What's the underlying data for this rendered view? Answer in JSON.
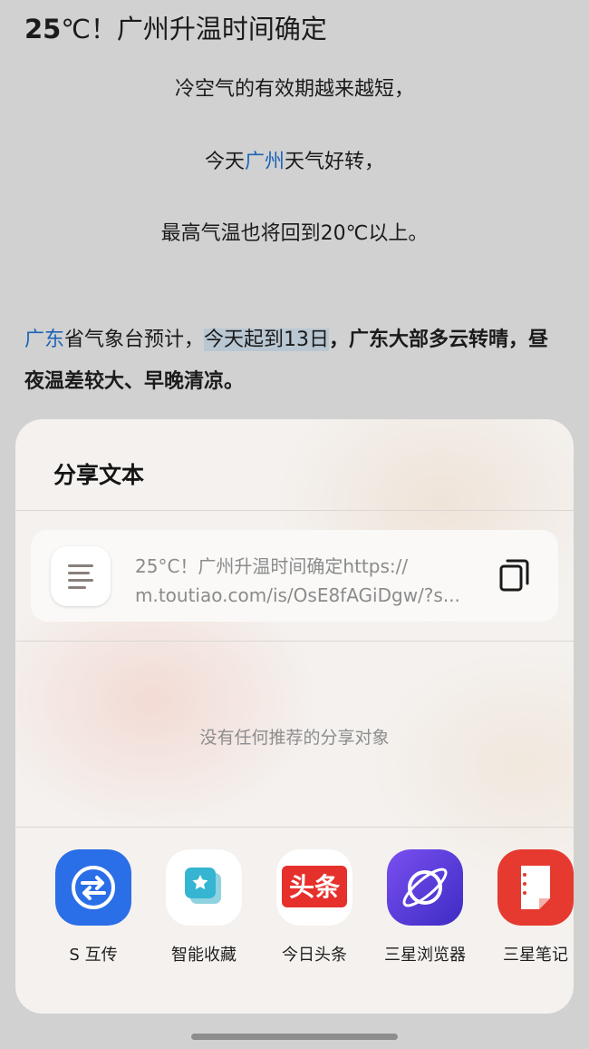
{
  "article": {
    "title_num": "25",
    "title_rest": "℃！广州升温时间确定",
    "line1": "冷空气的有效期越来越短，",
    "line2_pre": "今天",
    "line2_link": "广州",
    "line2_post": "天气好转，",
    "line3": "最高气温也将回到20℃以上。",
    "para_link": "广东",
    "para_text1": "省气象台预计，",
    "para_highlight": "今天起到13日",
    "para_bold": "，广东大部多云转晴，昼夜温差较大、早晚清凉。"
  },
  "share_sheet": {
    "title": "分享文本",
    "preview_line1": "25°C！广州升温时间确定https://",
    "preview_line2": "m.toutiao.com/is/OsE8fAGiDgw/?s...",
    "empty_message": "没有任何推荐的分享对象",
    "apps": [
      {
        "label": "S 互传",
        "icon": "s-share-icon"
      },
      {
        "label": "智能收藏",
        "icon": "smart-collect-icon"
      },
      {
        "label": "今日头条",
        "icon": "toutiao-icon",
        "icon_text": "头条"
      },
      {
        "label": "三星浏览器",
        "icon": "samsung-browser-icon"
      },
      {
        "label": "三星笔记",
        "icon": "samsung-notes-icon"
      }
    ]
  },
  "colors": {
    "link": "#1f64b8",
    "highlight": "#b9c7d2",
    "toutiao_red": "#e6302b",
    "s_share_blue": "#2a6ee8",
    "browser_purple": "#5b3ed6",
    "notes_red": "#e63a30"
  }
}
